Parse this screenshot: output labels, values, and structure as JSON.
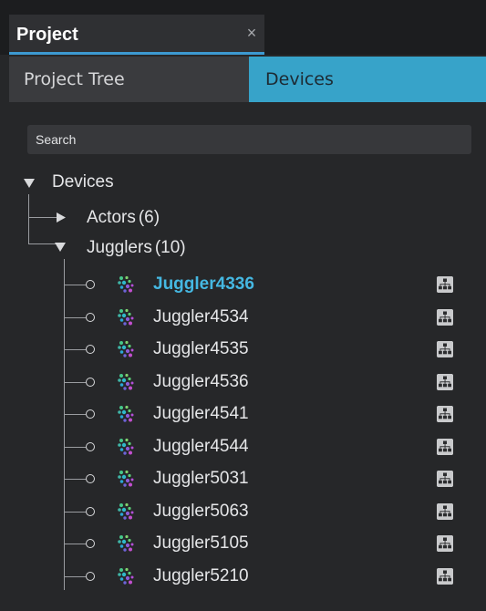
{
  "panel": {
    "title": "Project",
    "close_glyph": "×"
  },
  "tabs": [
    {
      "label": "Project Tree",
      "active": false
    },
    {
      "label": "Devices",
      "active": true
    }
  ],
  "search": {
    "placeholder": "Search",
    "value": ""
  },
  "tree": {
    "root": {
      "label": "Devices",
      "expanded": true
    },
    "groups": [
      {
        "label": "Actors",
        "count": "(6)",
        "expanded": false
      },
      {
        "label": "Jugglers",
        "count": "(10)",
        "expanded": true
      }
    ],
    "devices": [
      {
        "name": "Juggler4336",
        "selected": true
      },
      {
        "name": "Juggler4534",
        "selected": false
      },
      {
        "name": "Juggler4535",
        "selected": false
      },
      {
        "name": "Juggler4536",
        "selected": false
      },
      {
        "name": "Juggler4541",
        "selected": false
      },
      {
        "name": "Juggler4544",
        "selected": false
      },
      {
        "name": "Juggler5031",
        "selected": false
      },
      {
        "name": "Juggler5063",
        "selected": false
      },
      {
        "name": "Juggler5105",
        "selected": false
      },
      {
        "name": "Juggler5210",
        "selected": false
      }
    ],
    "device_icon": "juggler-device-icon",
    "action_icon": "network-topology-icon"
  },
  "colors": {
    "accent": "#37a3c9",
    "selected_text": "#45b8e2"
  }
}
